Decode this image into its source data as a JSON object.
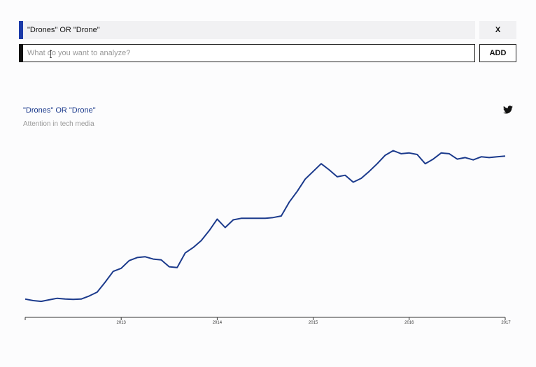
{
  "query": {
    "text": "\"Drones\" OR \"Drone\"",
    "accent_color": "#1b3aa8",
    "remove_label": "X"
  },
  "new_query": {
    "placeholder": "What do you want to analyze?",
    "value": "",
    "accent_color": "#111111",
    "add_label": "ADD"
  },
  "share": {
    "icon": "twitter-icon"
  },
  "chart_data": {
    "type": "line",
    "title": "\"Drones\" OR \"Drone\"",
    "subtitle": "Attention in tech media",
    "xlabel": "",
    "ylabel": "",
    "grid": false,
    "line_color": "#1b3a8c",
    "xlim": [
      2012.0,
      2017.0
    ],
    "ylim": [
      0,
      100
    ],
    "x_ticks": [
      "2013",
      "2014",
      "2015",
      "2016",
      "2017"
    ],
    "x_tick_values": [
      2013,
      2014,
      2015,
      2016,
      2017
    ],
    "x": [
      2012.0,
      2012.083,
      2012.167,
      2012.25,
      2012.333,
      2012.417,
      2012.5,
      2012.583,
      2012.667,
      2012.75,
      2012.833,
      2012.917,
      2013.0,
      2013.083,
      2013.167,
      2013.25,
      2013.333,
      2013.417,
      2013.5,
      2013.583,
      2013.667,
      2013.75,
      2013.833,
      2013.917,
      2014.0,
      2014.083,
      2014.167,
      2014.25,
      2014.333,
      2014.417,
      2014.5,
      2014.583,
      2014.667,
      2014.75,
      2014.833,
      2014.917,
      2015.0,
      2015.083,
      2015.167,
      2015.25,
      2015.333,
      2015.417,
      2015.5,
      2015.583,
      2015.667,
      2015.75,
      2015.833,
      2015.917,
      2016.0,
      2016.083,
      2016.167,
      2016.25,
      2016.333,
      2016.417,
      2016.5,
      2016.583,
      2016.667,
      2016.75,
      2016.833,
      2016.917,
      2017.0
    ],
    "values": [
      1.0,
      0.0,
      -0.5,
      0.5,
      1.5,
      1.0,
      0.8,
      1.0,
      3.0,
      5.5,
      12.0,
      19.0,
      21.0,
      26.0,
      28.0,
      28.5,
      27.0,
      26.5,
      22.0,
      21.5,
      31.0,
      34.5,
      39.0,
      45.5,
      53.0,
      47.5,
      52.5,
      53.5,
      53.5,
      53.5,
      53.5,
      54.0,
      55.0,
      64.0,
      71.0,
      79.0,
      84.0,
      89.0,
      85.0,
      80.5,
      81.5,
      77.0,
      79.5,
      84.0,
      89.0,
      94.5,
      97.5,
      95.5,
      96.0,
      95.0,
      89.0,
      92.0,
      96.0,
      95.5,
      92.0,
      93.0,
      91.5,
      93.5,
      93.0,
      93.5,
      94.0
    ]
  }
}
